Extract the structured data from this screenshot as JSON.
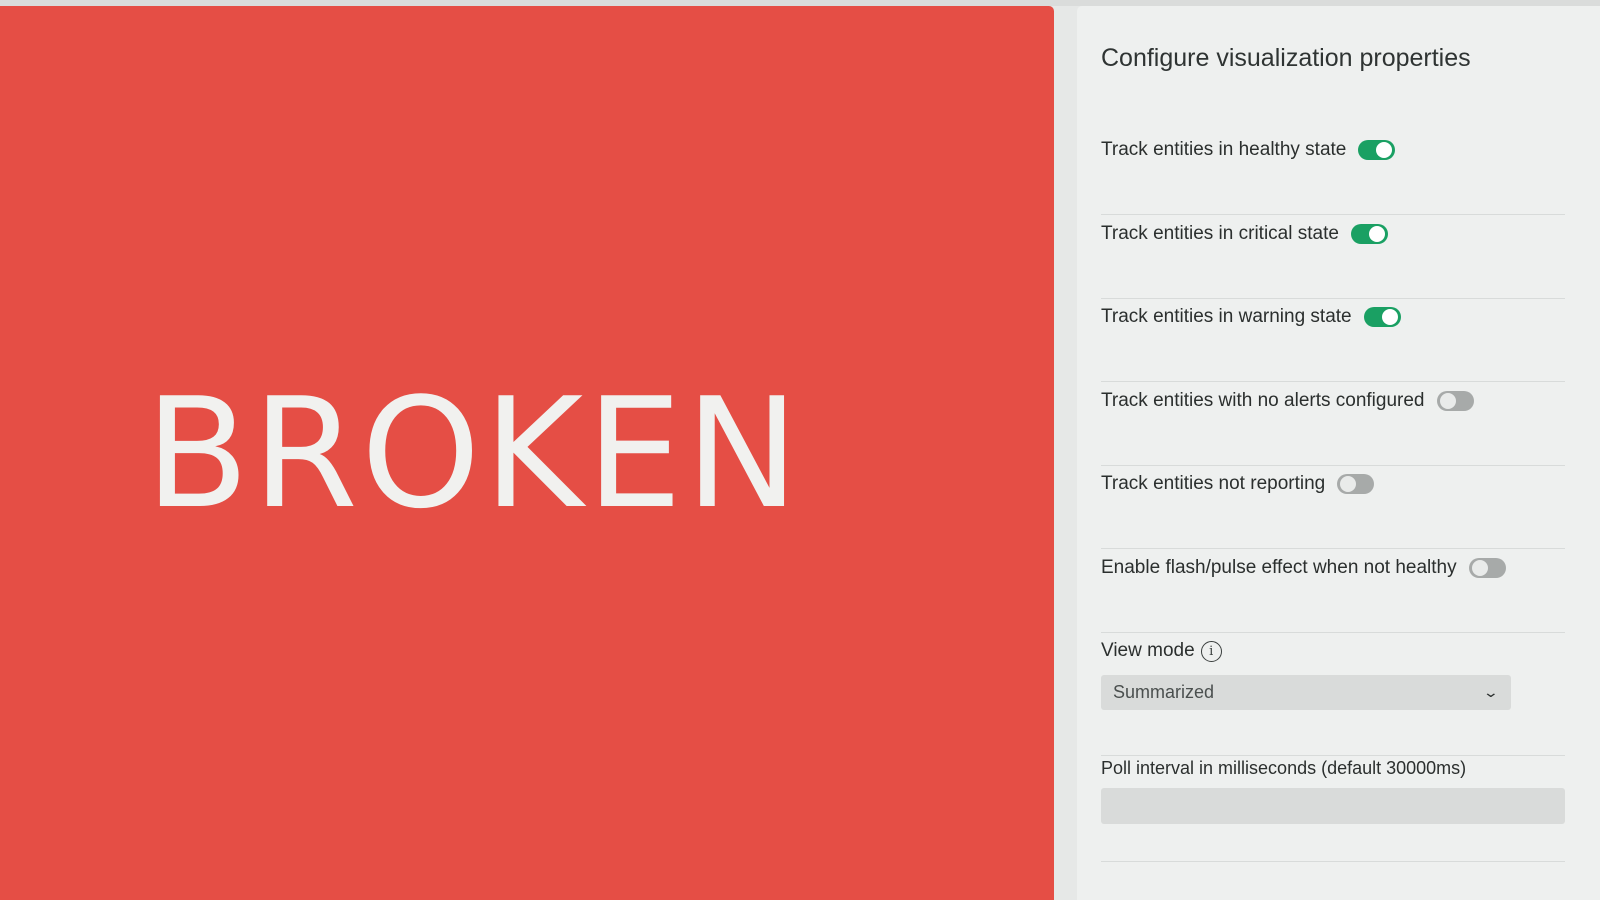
{
  "visualization": {
    "status_text": "BROKEN",
    "status_color": "#e54e45"
  },
  "panel": {
    "title": "Configure visualization properties",
    "toggles": [
      {
        "label": "Track entities in healthy state",
        "on": true
      },
      {
        "label": "Track entities in critical state",
        "on": true
      },
      {
        "label": "Track entities in warning state",
        "on": true
      },
      {
        "label": "Track entities with no alerts configured",
        "on": false
      },
      {
        "label": "Track entities not reporting",
        "on": false
      },
      {
        "label": "Enable flash/pulse effect when not healthy",
        "on": false
      }
    ],
    "view_mode": {
      "label": "View mode",
      "info_icon": "info-circle-icon",
      "selected": "Summarized",
      "chevron_icon": "chevron-down-icon"
    },
    "poll_interval": {
      "label": "Poll interval in milliseconds (default 30000ms)",
      "value": "",
      "placeholder": ""
    }
  },
  "colors": {
    "toggle_on": "#1aa063",
    "toggle_off": "#a7aaa9",
    "panel_bg": "#eef0ef"
  }
}
